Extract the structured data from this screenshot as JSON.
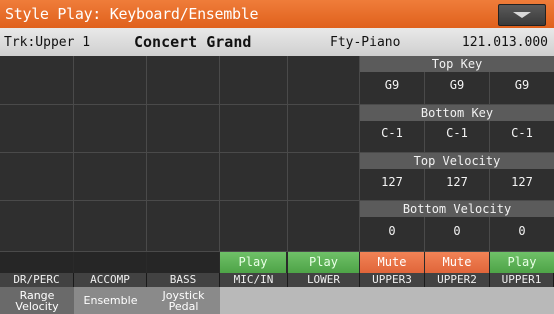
{
  "header": {
    "title": "Style Play: Keyboard/Ensemble",
    "menu_icon": "chevron-down-icon"
  },
  "info": {
    "track": "Trk:Upper 1",
    "sound": "Concert Grand",
    "bank": "Fty-Piano",
    "number": "121.013.000"
  },
  "params": {
    "top_key": {
      "label": "Top Key",
      "values": [
        "G9",
        "G9",
        "G9"
      ]
    },
    "bottom_key": {
      "label": "Bottom Key",
      "values": [
        "C-1",
        "C-1",
        "C-1"
      ]
    },
    "top_velocity": {
      "label": "Top Velocity",
      "values": [
        "127",
        "127",
        "127"
      ]
    },
    "bottom_velocity": {
      "label": "Bottom Velocity",
      "values": [
        "0",
        "0",
        "0"
      ]
    }
  },
  "play_states": [
    "",
    "",
    "",
    "Play",
    "Play",
    "Mute",
    "Mute",
    "Play"
  ],
  "tracks": [
    "DR/PERC",
    "ACCOMP",
    "BASS",
    "MIC/IN",
    "LOWER",
    "UPPER3",
    "UPPER2",
    "UPPER1"
  ],
  "tabs": [
    "Range Velocity",
    "Ensemble",
    "Joystick Pedal"
  ]
}
